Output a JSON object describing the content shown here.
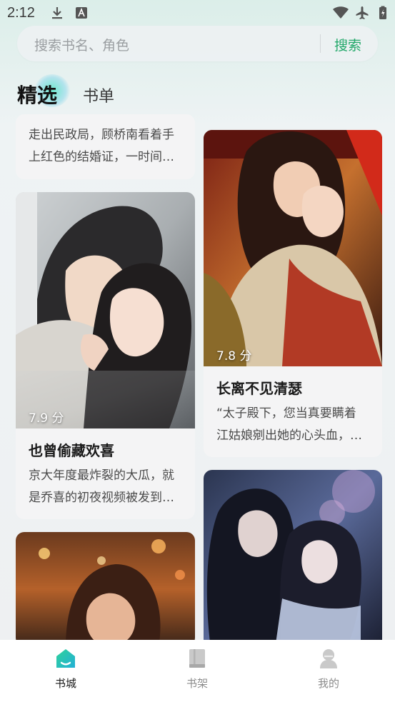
{
  "status_bar": {
    "time": "2:12"
  },
  "search": {
    "placeholder": "搜索书名、角色",
    "button_label": "搜索"
  },
  "tabs": [
    {
      "label": "精选",
      "active": true
    },
    {
      "label": "书单",
      "active": false
    }
  ],
  "books": [
    {
      "desc_lines": [
        "走出民政局，顾桥南看着手",
        "上红色的结婚证，一时间…"
      ]
    },
    {
      "score": "7.9 分",
      "title": "也曾偷藏欢喜",
      "desc_lines": [
        "京大年度最炸裂的大瓜，就",
        "是乔喜的初夜视频被发到…"
      ]
    },
    {
      "score": "7.8 分",
      "title": "长离不见清瑟",
      "desc_lines": [
        "“太子殿下，您当真要瞒着",
        "江姑娘剜出她的心头血，…"
      ]
    }
  ],
  "bottom_nav": [
    {
      "label": "书城",
      "icon": "bookstore-home-icon",
      "active": true
    },
    {
      "label": "书架",
      "icon": "bookshelf-icon",
      "active": false
    },
    {
      "label": "我的",
      "icon": "profile-icon",
      "active": false
    }
  ],
  "colors": {
    "accent": "#22a86a",
    "background": "#eef0f2"
  }
}
